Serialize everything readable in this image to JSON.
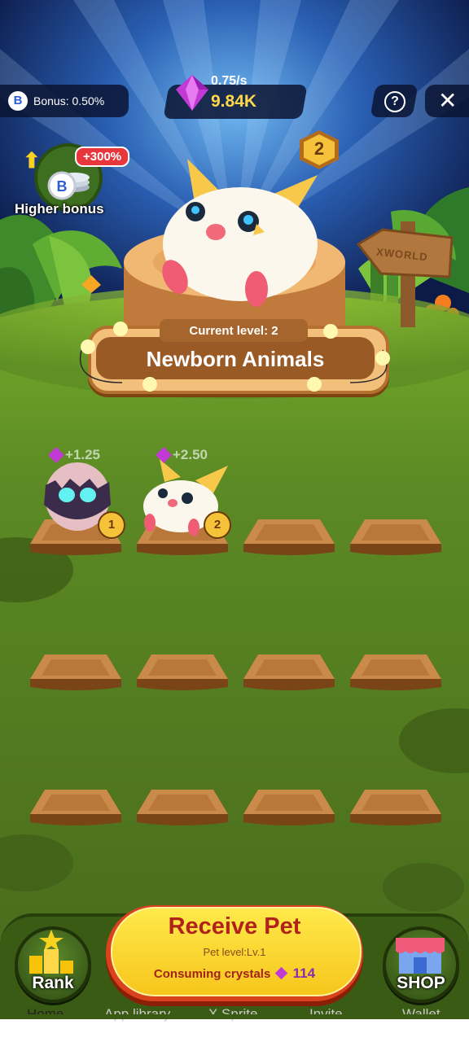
{
  "header": {
    "bonus_label": "Bonus: 0.50%",
    "rate": "0.75/s",
    "crystals": "9.84K",
    "help_icon": "question-icon",
    "close_icon": "close-icon"
  },
  "higher_bonus": {
    "percent": "+300%",
    "label": "Higher bonus"
  },
  "featured": {
    "badge_level": "2",
    "current_level": "Current level: 2",
    "title": "Newborn Animals",
    "sign_text": "XWORLD"
  },
  "slots": [
    {
      "yield": "+1.25",
      "level": "1",
      "pet": "egg"
    },
    {
      "yield": "+2.50",
      "level": "2",
      "pet": "creature"
    }
  ],
  "actions": {
    "rank_label": "Rank",
    "shop_label": "SHOP",
    "receive_title": "Receive Pet",
    "pet_level": "Pet level:Lv.1",
    "consume_label": "Consuming crystals",
    "consume_value": "114"
  },
  "nav": [
    "Home",
    "App library",
    "X Sprite",
    "Invite",
    "Wallet"
  ]
}
